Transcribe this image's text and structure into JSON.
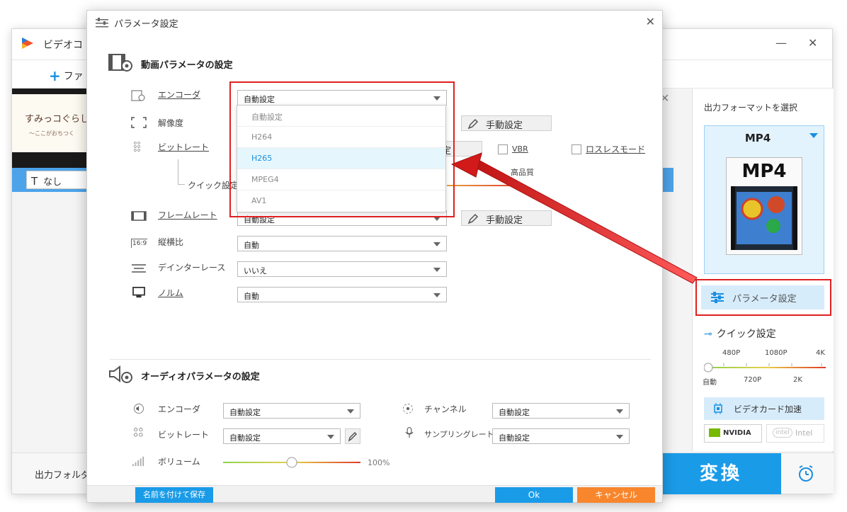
{
  "app": {
    "title": "ビデオコ",
    "add_label": "ファ",
    "thumb_title": "すみっコぐらし",
    "thumb_sub": "〜ここがおちつく",
    "subtitle_value": "なし",
    "output_folder_label": "出力フォルダ",
    "convert_label": "変換",
    "right_panel": {
      "format_label": "出力フォーマットを選択",
      "format_name": "MP4",
      "format_icon_text": "MP4",
      "param_button": "パラメータ設定",
      "quick_label": "クイック設定",
      "slider_top": [
        "480P",
        "1080P",
        "4K"
      ],
      "slider_bottom": [
        "自動",
        "720P",
        "2K"
      ],
      "gpu_label": "ビデオカード加速",
      "nvidia_label": "NVIDIA",
      "intel_label": "Intel"
    }
  },
  "dialog": {
    "title": "パラメータ設定",
    "video": {
      "title": "動画パラメータの設定",
      "encoder_label": "エンコーダ",
      "encoder_value": "自動設定",
      "resolution_label": "解像度",
      "bitrate_label": "ビットレート",
      "quick_label": "クイック設定",
      "high_quality": "高品質",
      "framerate_label": "フレームレート",
      "framerate_value": "自動設定",
      "aspect_label": "縦横比",
      "aspect_value": "自動",
      "deinterlace_label": "デインターレース",
      "deinterlace_value": "いいえ",
      "norm_label": "ノルム",
      "norm_value": "自動",
      "manual_button": "手動設定",
      "manual_button_partial": "定",
      "vbr_label": "VBR",
      "lossless_label": "ロスレスモード",
      "encoder_options": [
        "自動設定",
        "H264",
        "H265",
        "MPEG4",
        "AV1"
      ],
      "encoder_highlighted": "H265"
    },
    "audio": {
      "title": "オーディオパラメータの設定",
      "encoder_label": "エンコーダ",
      "encoder_value": "自動設定",
      "bitrate_label": "ビットレート",
      "bitrate_value": "自動設定",
      "volume_label": "ボリューム",
      "volume_value": "100%",
      "volume_level": 0.5,
      "channel_label": "チャンネル",
      "channel_value": "自動設定",
      "sample_label": "サンプリングレート",
      "sample_value": "自動設定"
    },
    "footer": {
      "save_as": "名前を付けて保存",
      "ok": "Ok",
      "cancel": "キャンセル"
    }
  },
  "colors": {
    "accent": "#1a9be8",
    "highlight": "#e02020",
    "cancel": "#f8862c",
    "selected_bg": "#e6f6fd"
  }
}
